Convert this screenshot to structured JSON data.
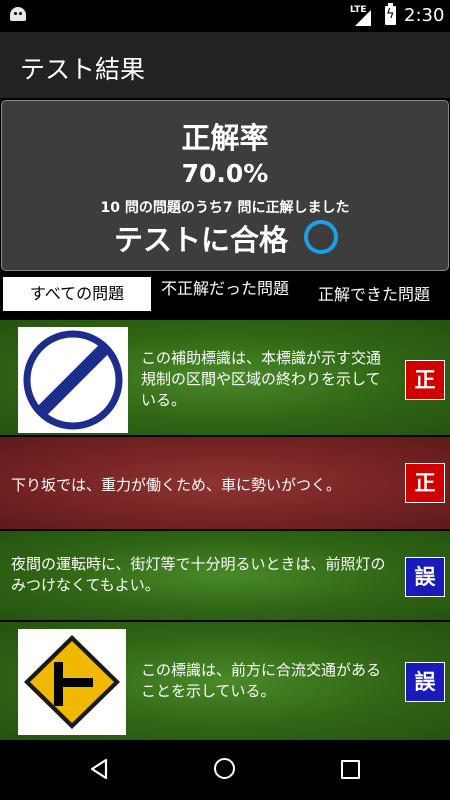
{
  "status_bar": {
    "network": "LTE",
    "time": "2:30"
  },
  "app_bar": {
    "title": "テスト結果"
  },
  "result": {
    "heading": "正解率",
    "percent": "70.0%",
    "summary": "10 問の問題のうち7 問に正解しました",
    "verdict": "テストに合格"
  },
  "tabs": [
    {
      "label": "すべての問題",
      "selected": true
    },
    {
      "label": "不正解だった問題",
      "selected": false
    },
    {
      "label": "正解できた問題",
      "selected": false
    }
  ],
  "questions": [
    {
      "text": "この補助標識は、本標識が示す交通規制の区間や区域の終わりを示している。",
      "badge": "正",
      "color": "green",
      "image": "end-of-restriction-sign-icon"
    },
    {
      "text": "下り坂では、重力が働くため、車に勢いがつく。",
      "badge": "正",
      "color": "red",
      "image": null
    },
    {
      "text": "夜間の運転時に、街灯等で十分明るいときは、前照灯のみつけなくてもよい。",
      "badge": "誤",
      "color": "green",
      "image": null
    },
    {
      "text": "この標識は、前方に合流交通があることを示している。",
      "badge": "誤",
      "color": "green",
      "image": "merging-traffic-sign-icon"
    }
  ],
  "colors": {
    "correct_badge": "#d00000",
    "wrong_badge": "#1a1ab8",
    "pass_circle": "#1ea0e6"
  }
}
